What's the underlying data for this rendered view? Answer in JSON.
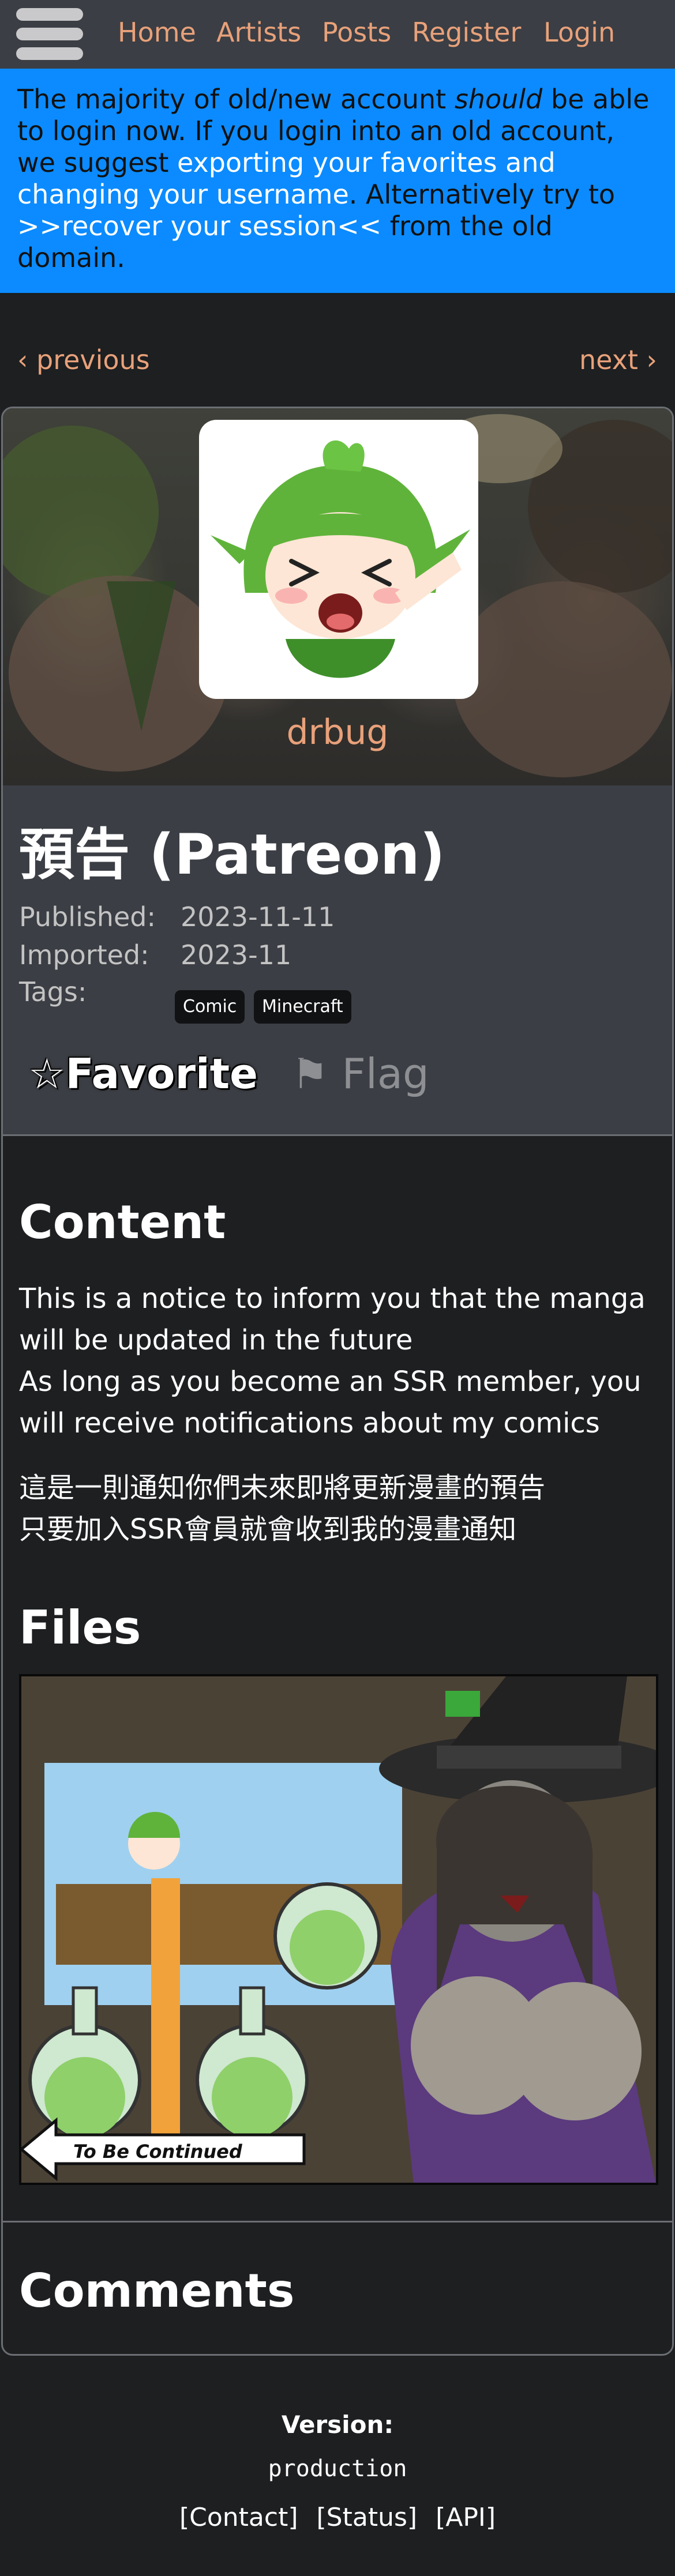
{
  "nav": {
    "links": [
      "Home",
      "Artists",
      "Posts",
      "Register",
      "Login"
    ]
  },
  "announcement": {
    "t1": "The majority of old/new account ",
    "t1_em": "should",
    "t1_end": " be able to login now. If you login into an old account, we suggest ",
    "link1": "exporting your favorites and changing your username",
    "t2": ". Alternatively try to ",
    "link2": ">>recover your session<<",
    "t3": " from the old domain."
  },
  "pager": {
    "previous": "previous",
    "next": "next"
  },
  "post": {
    "artist": "drbug",
    "title": "預告 (Patreon)",
    "published_label": "Published:",
    "published": "2023-11-11",
    "imported_label": "Imported:",
    "imported": "2023-11",
    "tags_label": "Tags:",
    "tags": [
      "Comic",
      "Minecraft"
    ],
    "favorite_label": "Favorite",
    "flag_label": "Flag"
  },
  "content": {
    "heading": "Content",
    "para1": "This is a notice to inform you that the manga will be updated in the future\nAs long as you become an SSR member, you will receive notifications about my comics",
    "para2": "這是一則通知你們未來即將更新漫畫的預告\n只要加入SSR會員就會收到我的漫畫通知"
  },
  "files": {
    "heading": "Files",
    "banner_text": "To Be Continued"
  },
  "comments": {
    "heading": "Comments"
  },
  "footer": {
    "version_label": "Version:",
    "version": "production",
    "links": [
      "[Contact]",
      "[Status]",
      "[API]"
    ]
  },
  "colors": {
    "accent": "#e8a17a",
    "announce_bg": "#0b8bff",
    "panel": "#3b3e44",
    "bg": "#1d1f21"
  }
}
